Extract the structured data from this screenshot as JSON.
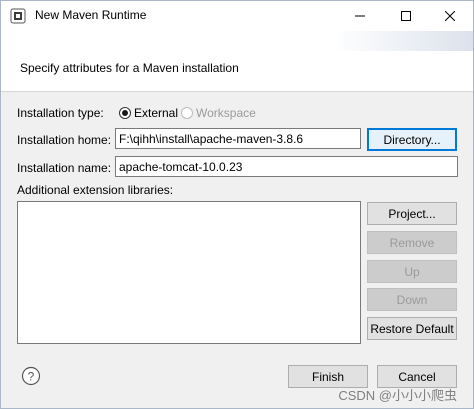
{
  "window": {
    "title": "New Maven Runtime",
    "minimize_icon": "minimize-icon",
    "maximize_icon": "maximize-icon",
    "close_icon": "close-icon",
    "minimize_glyph": "—",
    "maximize_glyph": "☐",
    "close_glyph": "✕"
  },
  "header": {
    "description": "Specify attributes for a Maven installation"
  },
  "form": {
    "installation_type": {
      "label": "Installation type:",
      "options": [
        {
          "label": "External",
          "selected": true,
          "enabled": true
        },
        {
          "label": "Workspace",
          "selected": false,
          "enabled": false
        }
      ]
    },
    "installation_home": {
      "label": "Installation home:",
      "value": "F:\\qihh\\install\\apache-maven-3.8.6"
    },
    "directory_button": "Directory...",
    "installation_name": {
      "label": "Installation name:",
      "value": "apache-tomcat-10.0.23"
    },
    "extension_libraries": {
      "label": "Additional extension libraries:",
      "items": []
    }
  },
  "side_buttons": {
    "project": "Project...",
    "remove": "Remove",
    "up": "Up",
    "down": "Down",
    "restore_default": "Restore Default"
  },
  "footer": {
    "help_glyph": "?",
    "finish": "Finish",
    "cancel": "Cancel"
  },
  "watermark": "CSDN @小小小爬虫",
  "colors": {
    "dialog_bg": "#f0f0f0",
    "focus_border": "#0078d7"
  }
}
